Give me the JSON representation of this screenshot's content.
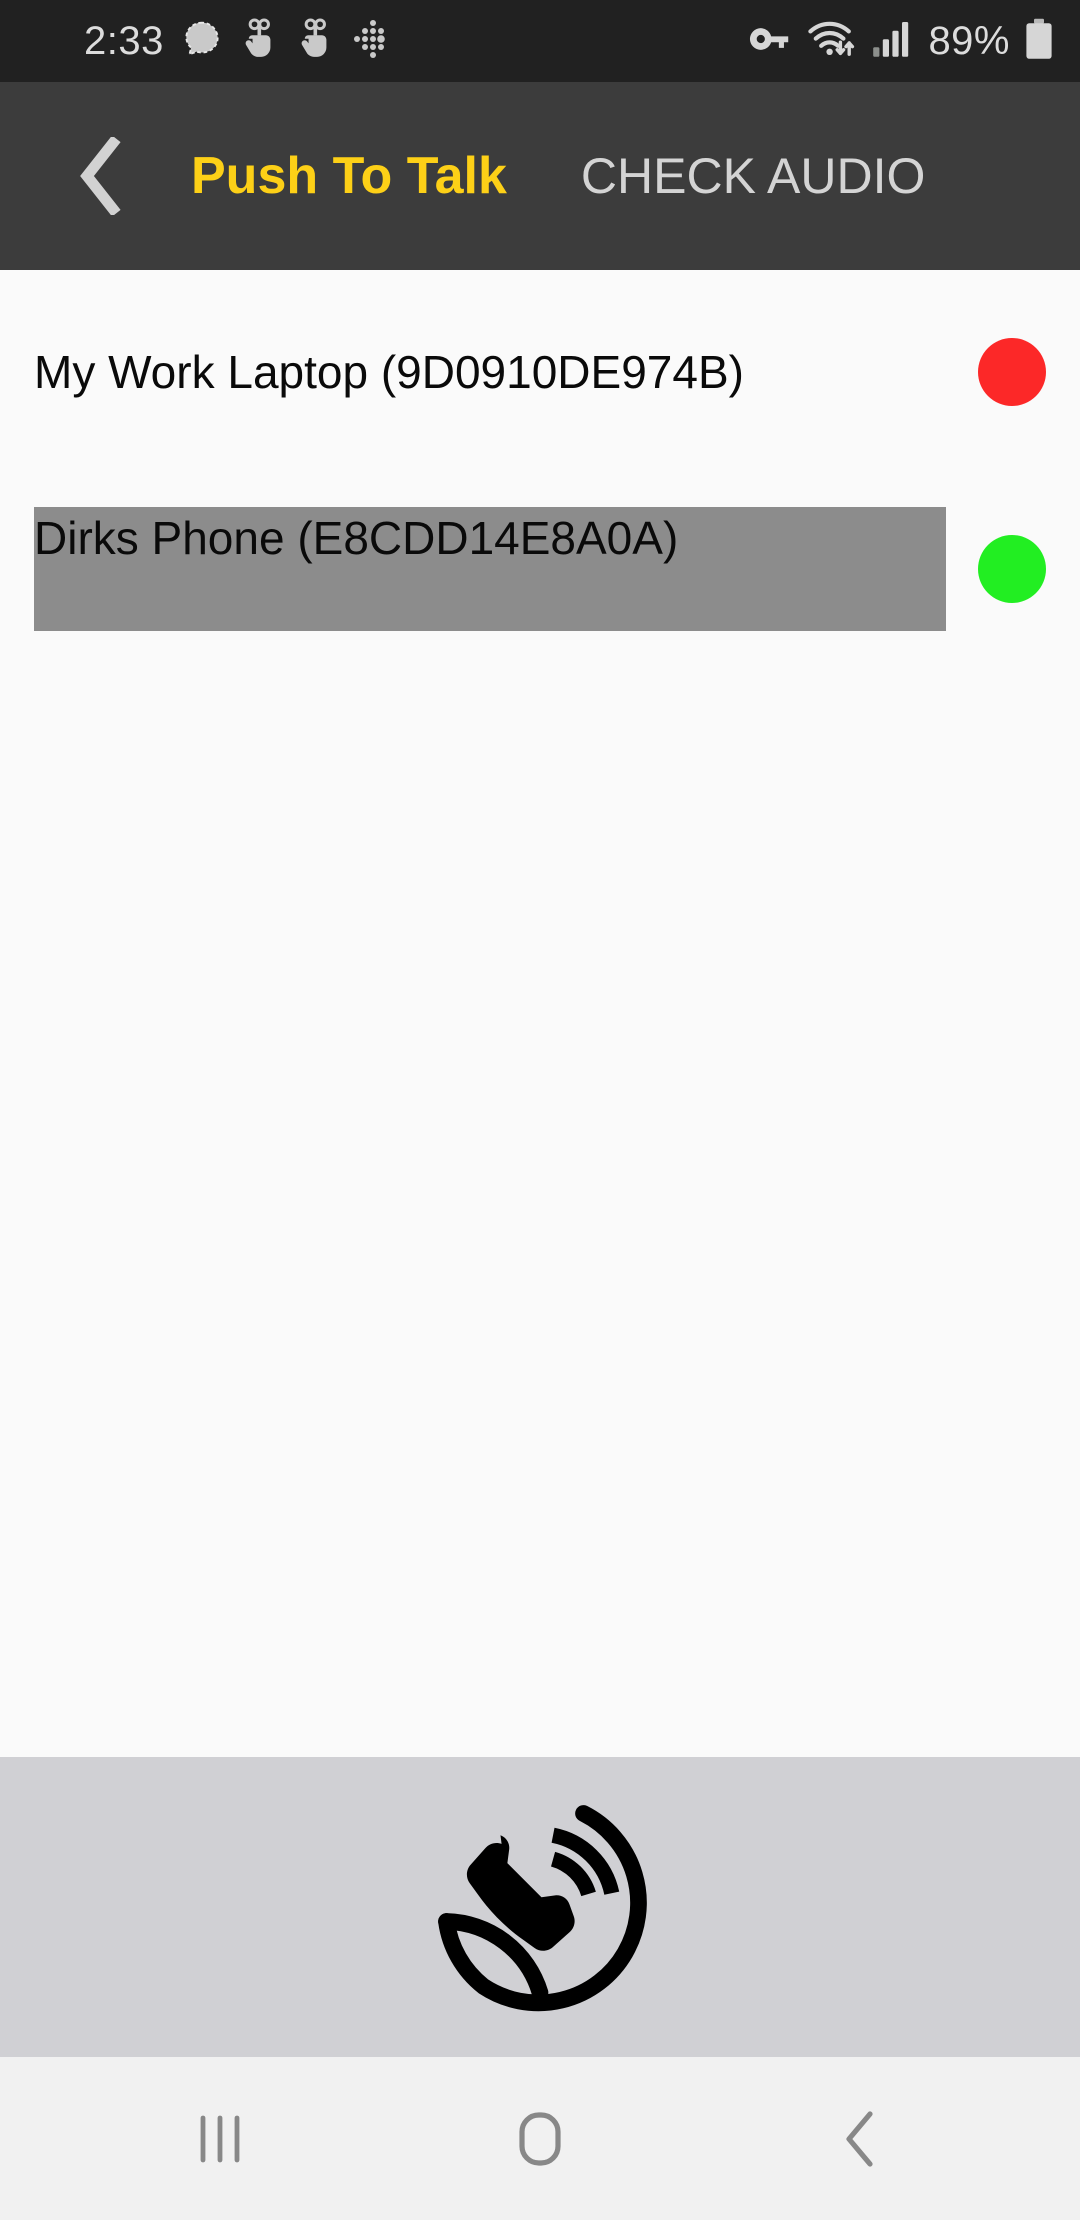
{
  "status_bar": {
    "time": "2:33",
    "battery_percent": "89%",
    "left_icons": [
      "signal-messenger-icon",
      "hand-gesture-icon",
      "hand-gesture-icon",
      "dotted-arrow-icon"
    ],
    "right_icons": [
      "vpn-key-icon",
      "wifi-transfer-icon",
      "cellular-signal-icon",
      "battery-icon"
    ],
    "background_color": "#212121",
    "foreground_color": "#d6d6d6"
  },
  "app_bar": {
    "back_label": "‹",
    "title": "Push To Talk",
    "action_label": "CHECK AUDIO",
    "title_color": "#fdd017",
    "background_color": "#3c3c3c",
    "action_color": "#d4d4d4"
  },
  "device_list": {
    "items": [
      {
        "name": "My Work Laptop (9D0910DE974B)",
        "status": "offline",
        "status_color": "#fc2828",
        "selected": false
      },
      {
        "name": "Dirks Phone (E8CDD14E8A0A)",
        "status": "online",
        "status_color": "#22ee22",
        "selected": true
      }
    ],
    "selected_background": "#8c8c8c",
    "background_color": "#fafafa"
  },
  "ptt_panel": {
    "icon": "push-to-talk-handset-icon",
    "background_color": "#d0d0d4",
    "icon_color": "#000000"
  },
  "nav_bar": {
    "recents_label": "recents-icon",
    "home_label": "home-icon",
    "back_label": "back-icon",
    "background_color": "#f1f1f1",
    "icon_color": "#888888"
  }
}
